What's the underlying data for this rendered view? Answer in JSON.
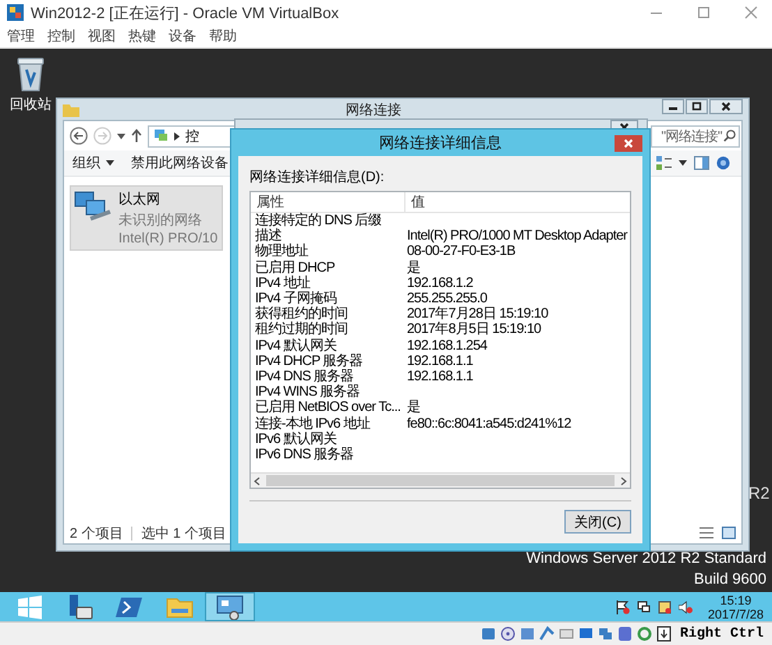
{
  "window": {
    "title": "Win2012-2 [正在运行] - Oracle VM VirtualBox"
  },
  "menu": [
    "管理",
    "控制",
    "视图",
    "热键",
    "设备",
    "帮助"
  ],
  "desktop": {
    "icons": [
      {
        "label": "回收站"
      }
    ],
    "branding_fragment": "R2",
    "branding": [
      "Windows Server 2012 R2 Standard",
      "Build 9600"
    ]
  },
  "explorer": {
    "title": "网络连接",
    "address": "控",
    "search_placeholder": "\"网络连接\"",
    "toolbar": [
      {
        "label": "组织",
        "dropdown": true
      },
      {
        "label": "禁用此网络设备",
        "dropdown": false
      }
    ],
    "items": [
      {
        "name": "以太网",
        "status": "未识别的网络",
        "device": "Intel(R) PRO/10",
        "selected": true
      }
    ],
    "status_bar": [
      "2 个项目",
      "选中 1 个项目"
    ]
  },
  "dialog": {
    "title": "网络连接详细信息",
    "list_label": "网络连接详细信息(D):",
    "columns": [
      "属性",
      "值"
    ],
    "rows": [
      {
        "property": "连接特定的 DNS 后缀"
      },
      {
        "property": "描述",
        "value": "Intel(R) PRO/1000 MT Desktop Adapter"
      },
      {
        "property": "物理地址",
        "value": "08-00-27-F0-E3-1B"
      },
      {
        "property": "已启用 DHCP",
        "value": "是"
      },
      {
        "property": "IPv4 地址",
        "value": "192.168.1.2"
      },
      {
        "property": "IPv4 子网掩码",
        "value": "255.255.255.0"
      },
      {
        "property": "获得租约的时间",
        "value": "2017年7月28日 15:19:10"
      },
      {
        "property": "租约过期的时间",
        "value": "2017年8月5日 15:19:10"
      },
      {
        "property": "IPv4 默认网关",
        "value": "192.168.1.254"
      },
      {
        "property": "IPv4 DHCP 服务器",
        "value": "192.168.1.1"
      },
      {
        "property": "IPv4 DNS 服务器",
        "value": "192.168.1.1"
      },
      {
        "property": "IPv4 WINS 服务器"
      },
      {
        "property": "已启用 NetBIOS over Tc...",
        "value": "是"
      },
      {
        "property": "连接-本地 IPv6 地址",
        "value": "fe80::6c:8041:a545:d241%12"
      },
      {
        "property": "IPv6 默认网关"
      },
      {
        "property": "IPv6 DNS 服务器"
      }
    ],
    "button": "关闭(C)"
  },
  "taskbar": {
    "apps": [
      {
        "kind": "start",
        "selected": false
      },
      {
        "kind": "server-manager",
        "selected": false
      },
      {
        "kind": "powershell",
        "selected": false
      },
      {
        "kind": "file-explorer",
        "selected": false
      },
      {
        "kind": "network",
        "selected": true
      }
    ],
    "time": "15:19",
    "date": "2017/7/28"
  },
  "vm_status_bar": {
    "host_key": "Right Ctrl"
  }
}
